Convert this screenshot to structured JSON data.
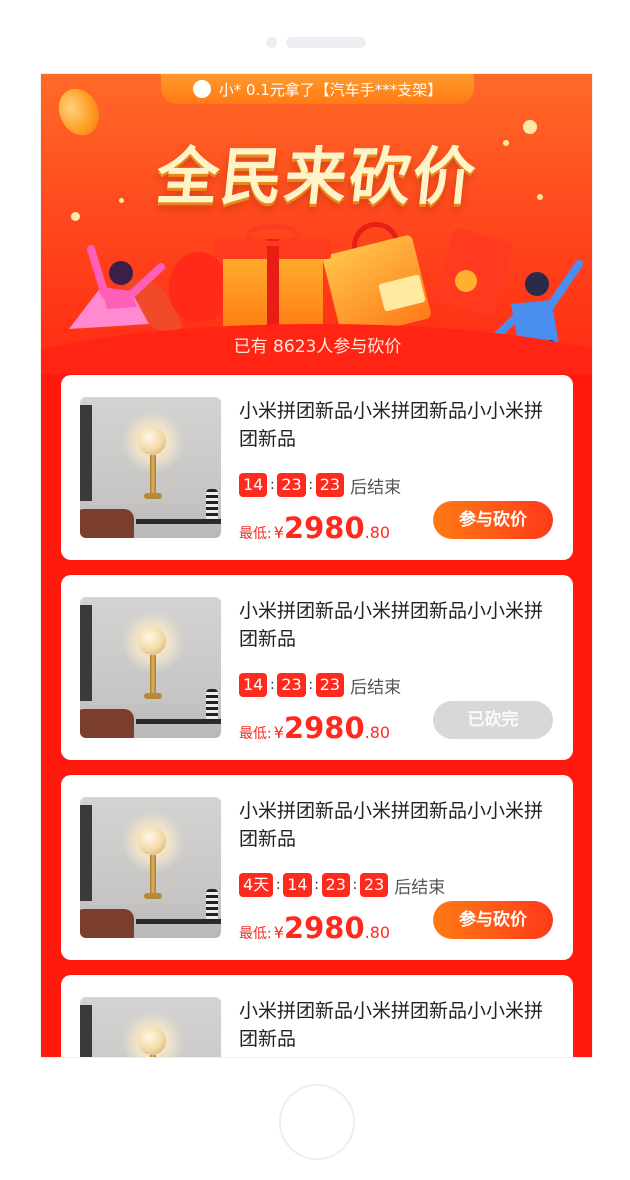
{
  "ticker": {
    "text": "小* 0.1元拿了【汽车手***支架】"
  },
  "hero": {
    "title": "全民来砍价",
    "participants": "已有 8623人参与砍价"
  },
  "products": [
    {
      "title": "小米拼团新品小米拼团新品小小米拼团新品",
      "countdown": [
        "14",
        "23",
        "23"
      ],
      "ends_text": "后结束",
      "price_label": "最低:",
      "currency": "¥",
      "price_int": "2980",
      "price_dec": ".80",
      "button": "参与砍价",
      "button_state": "active"
    },
    {
      "title": "小米拼团新品小米拼团新品小小米拼团新品",
      "countdown": [
        "14",
        "23",
        "23"
      ],
      "ends_text": "后结束",
      "price_label": "最低:",
      "currency": "¥",
      "price_int": "2980",
      "price_dec": ".80",
      "button": "已砍完",
      "button_state": "disabled"
    },
    {
      "title": "小米拼团新品小米拼团新品小小米拼团新品",
      "countdown": [
        "4天",
        "14",
        "23",
        "23"
      ],
      "ends_text": "后结束",
      "price_label": "最低:",
      "currency": "¥",
      "price_int": "2980",
      "price_dec": ".80",
      "button": "参与砍价",
      "button_state": "active"
    },
    {
      "title": "小米拼团新品小米拼团新品小小米拼团新品",
      "countdown": [],
      "ends_text": "",
      "price_label": "",
      "currency": "",
      "price_int": "",
      "price_dec": "",
      "button": "",
      "button_state": "hidden"
    }
  ],
  "colors": {
    "primary_red": "#ff2a1e",
    "button_orange": "#ff7a14",
    "disabled_gray": "#d8d8d8"
  }
}
